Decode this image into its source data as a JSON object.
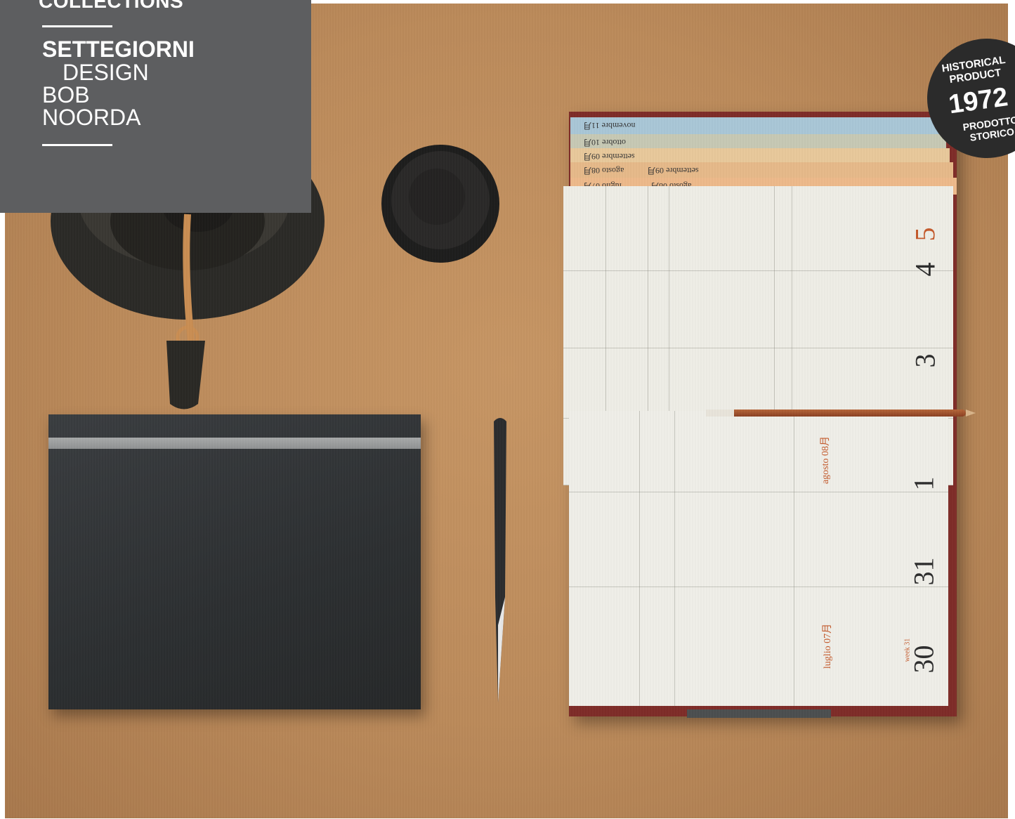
{
  "brand": {
    "collections": "COLLECTIONS",
    "name": "SETTEGIORNI",
    "design": "DESIGN",
    "bob": "BOB",
    "noorda": "NOORDA"
  },
  "badge": {
    "line1": "HISTORICAL PRODUCT",
    "year": "1972",
    "line2": "PRODOTTO STORICO"
  },
  "diary": {
    "tabs": [
      "novembre 11月",
      "ottobre 10月",
      "settembre 09月",
      "agosto 08月",
      "settembre 09月",
      "luglio 07月",
      "agosto 08月"
    ],
    "top_days": [
      "5",
      "4",
      "3"
    ],
    "bottom_days": [
      "1",
      "31",
      "30"
    ],
    "months": {
      "august": "agosto 08月",
      "july": "luglio 07月"
    },
    "week": "week 31"
  },
  "colors": {
    "accent": "#c45a2c",
    "brand_box": "#5d5e60",
    "desk": "#bb8a5a"
  }
}
